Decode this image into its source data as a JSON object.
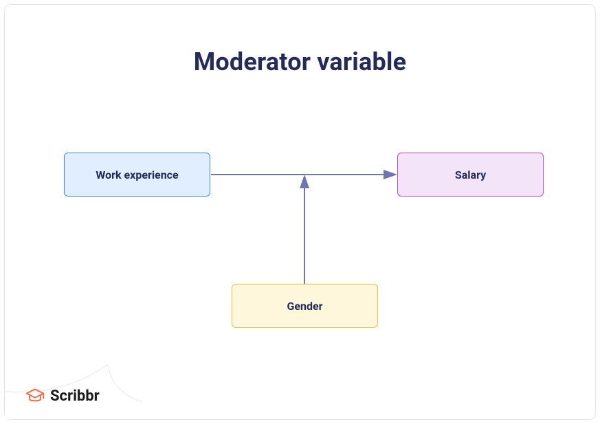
{
  "title": "Moderator variable",
  "nodes": {
    "independent": {
      "label": "Work experience"
    },
    "dependent": {
      "label": "Salary"
    },
    "moderator": {
      "label": "Gender"
    }
  },
  "brand": {
    "name": "Scribbr"
  },
  "colors": {
    "text": "#232a5c",
    "arrow": "#6b76b2",
    "blue_fill": "#e0eefd",
    "blue_border": "#3a8ae3",
    "purple_fill": "#f3e4fa",
    "purple_border": "#b853d6",
    "yellow_fill": "#fff7dc",
    "yellow_border": "#f2c233",
    "brand_orange": "#f26a3d"
  }
}
